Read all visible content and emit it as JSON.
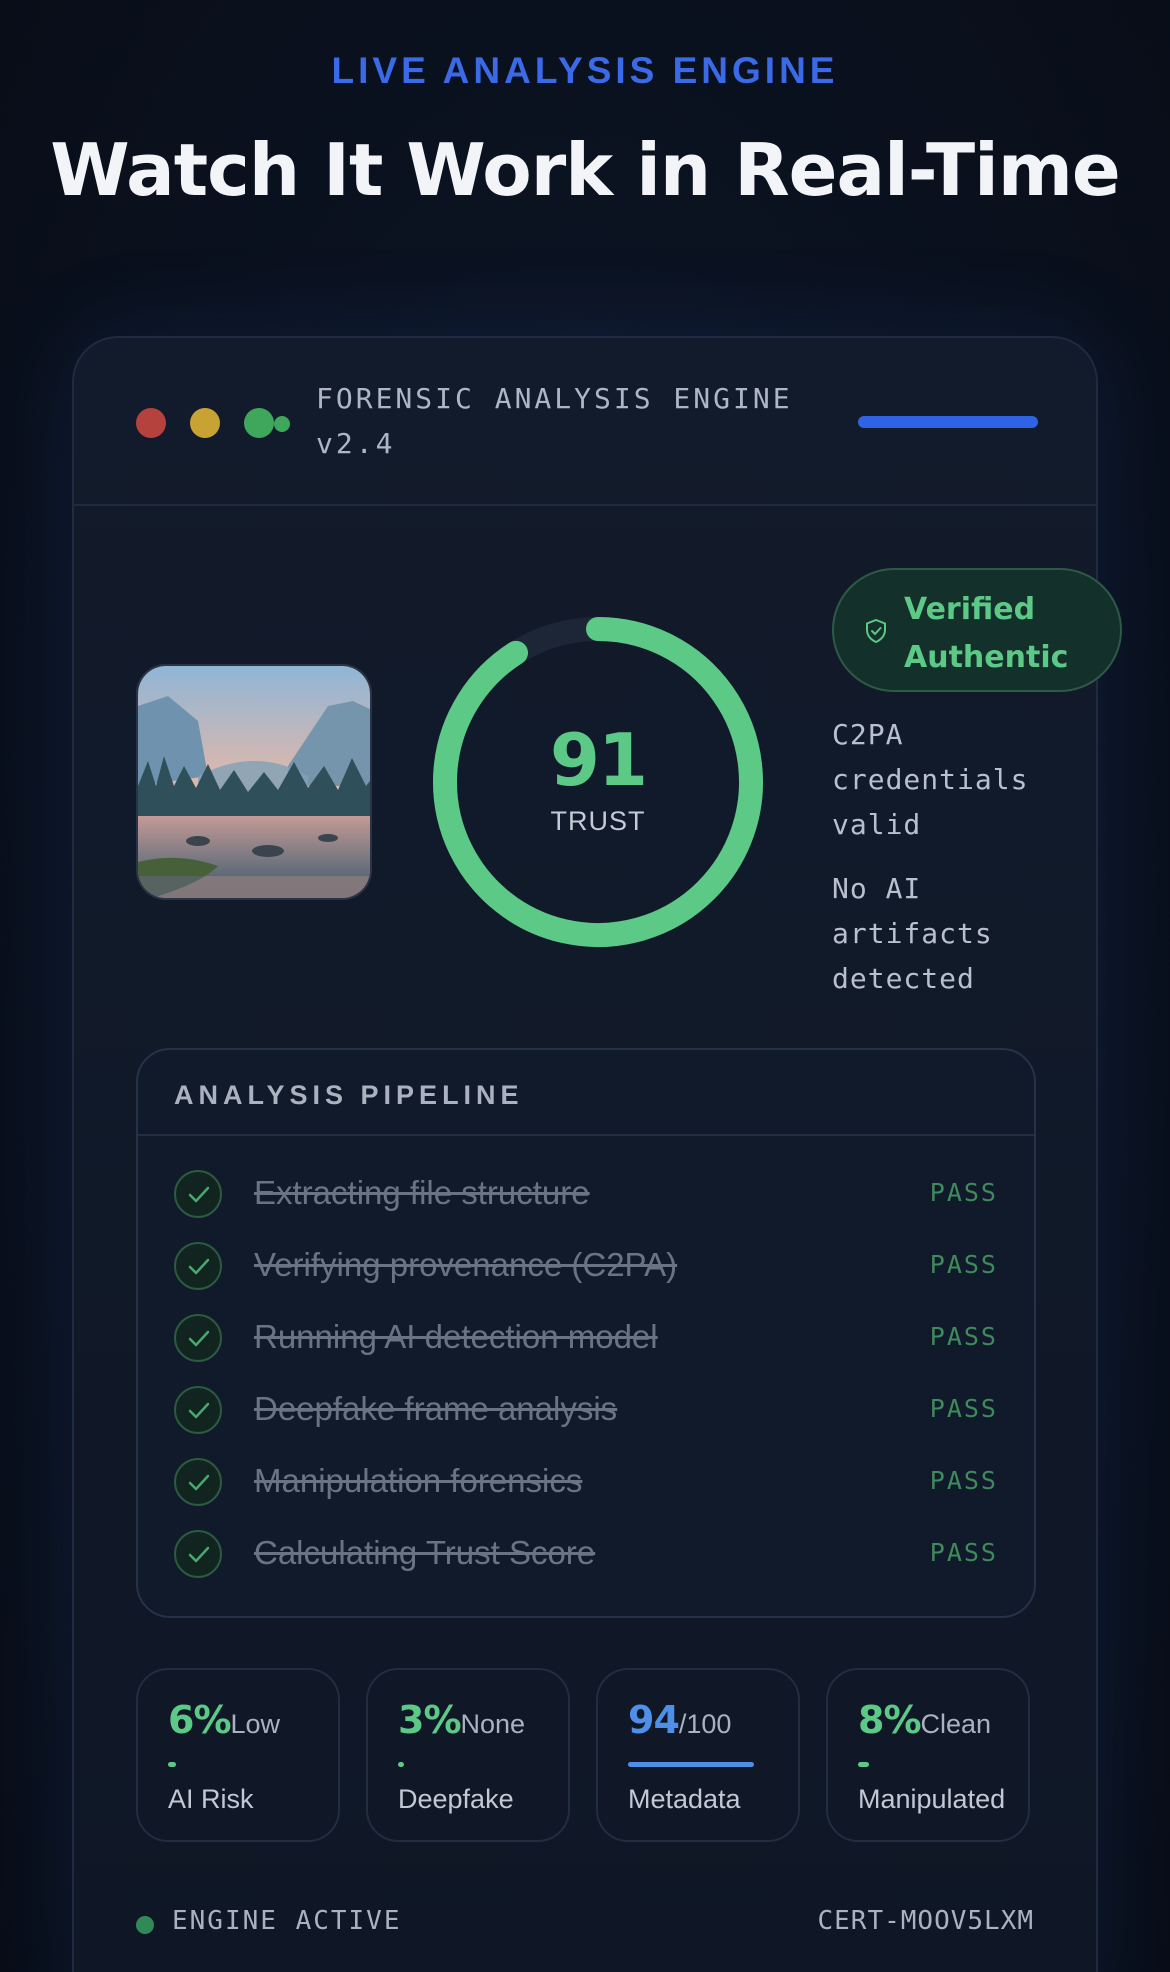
{
  "hero": {
    "eyebrow": "LIVE ANALYSIS ENGINE",
    "headline": "Watch It Work in Real-Time"
  },
  "window": {
    "title_line1": "FORENSIC ANALYSIS ENGINE",
    "title_line2": "v2.4",
    "controls": [
      "close",
      "minimize",
      "maximize"
    ],
    "accent": "#2f63e5"
  },
  "score": {
    "value": "91",
    "label": "TRUST",
    "fraction": 0.91,
    "color": "#5cc987"
  },
  "verdict": {
    "badge": "Verified Authentic",
    "badge_icon": "shield-check-icon",
    "notes": [
      "C2PA credentials valid",
      "No AI artifacts detected"
    ]
  },
  "pipeline": {
    "title": "ANALYSIS PIPELINE",
    "steps": [
      {
        "label": "Extracting file structure",
        "status": "PASS"
      },
      {
        "label": "Verifying provenance (C2PA)",
        "status": "PASS"
      },
      {
        "label": "Running AI detection model",
        "status": "PASS"
      },
      {
        "label": "Deepfake frame analysis",
        "status": "PASS"
      },
      {
        "label": "Manipulation forensics",
        "status": "PASS"
      },
      {
        "label": "Calculating Trust Score",
        "status": "PASS"
      }
    ]
  },
  "metrics": [
    {
      "value": "6%",
      "suffix": "Low",
      "label": "AI Risk",
      "fraction": 0.06,
      "color": "#5cc987"
    },
    {
      "value": "3%",
      "suffix": "None",
      "label": "Deepfake",
      "fraction": 0.03,
      "color": "#5cc987"
    },
    {
      "value": "94",
      "suffix": "/100",
      "label": "Metadata",
      "fraction": 0.94,
      "color": "#4f8fe8"
    },
    {
      "value": "8%",
      "suffix": "Clean",
      "label": "Manipulated",
      "fraction": 0.08,
      "color": "#5cc987"
    }
  ],
  "footer": {
    "status": "ENGINE ACTIVE",
    "cert": "CERT-MOOV5LXM"
  }
}
